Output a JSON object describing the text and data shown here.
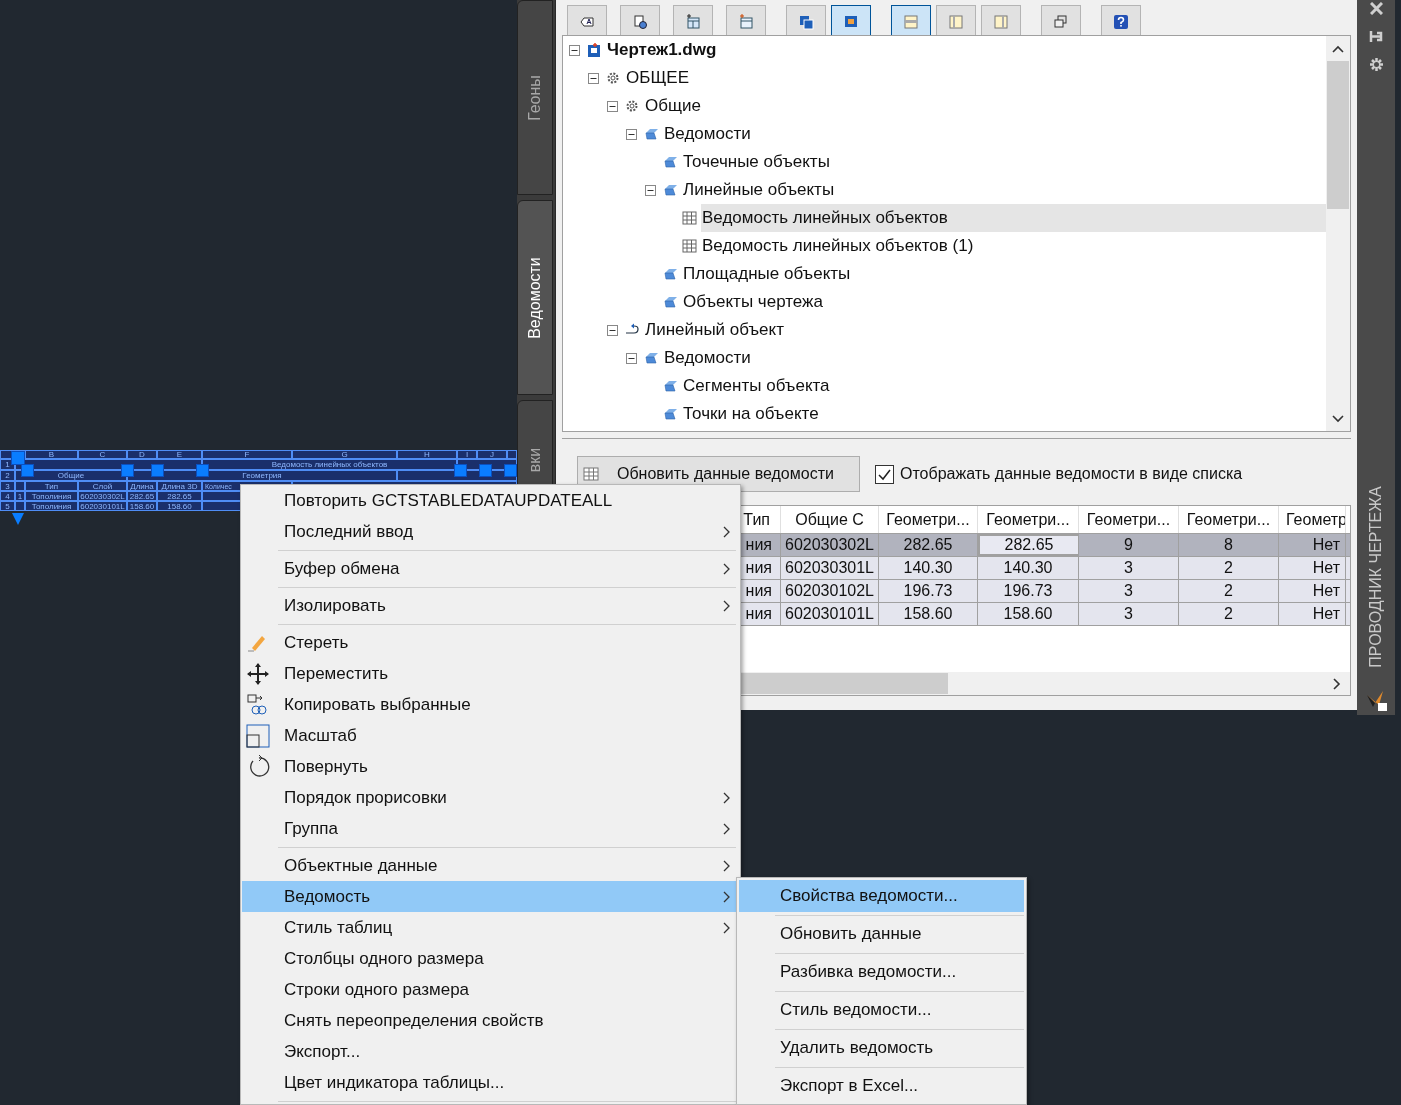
{
  "drawing_table": {
    "column_letters": [
      "B",
      "C",
      "D",
      "E",
      "F",
      "G",
      "H",
      "I",
      "J"
    ],
    "title": "Ведомость линейных объектов",
    "group_headers": [
      "Общие",
      "Геометрия"
    ],
    "row_numbers": [
      "1",
      "2",
      "3",
      "4",
      "5"
    ],
    "headers": [
      "Тип",
      "Слой",
      "Длина",
      "Длина 3D",
      "Количес"
    ],
    "rows": [
      {
        "number": "1",
        "cells": [
          "Тополиния",
          "602030302L",
          "282.65",
          "282.65"
        ]
      },
      {
        "cells": [
          "Тополиния",
          "602030101L",
          "158.60",
          "158.60"
        ]
      }
    ]
  },
  "side_tabs": [
    {
      "label": "Геоны",
      "selected": false
    },
    {
      "label": "Ведомости",
      "selected": true
    },
    {
      "label": "вки",
      "selected": false
    }
  ],
  "toolbar": [
    [
      {
        "kind": "label",
        "selected": false
      },
      {
        "kind": "find",
        "selected": false
      },
      {
        "kind": "add-table",
        "selected": false
      },
      {
        "kind": "add-list",
        "selected": false
      }
    ],
    [
      {
        "kind": "copy",
        "selected": false
      },
      {
        "kind": "paste",
        "selected": true
      }
    ],
    [
      {
        "kind": "panel-top",
        "selected": true
      },
      {
        "kind": "panel-left",
        "selected": false
      },
      {
        "kind": "panel-right",
        "selected": false
      }
    ],
    [
      {
        "kind": "windows",
        "selected": false
      }
    ],
    [
      {
        "kind": "help",
        "selected": false
      }
    ]
  ],
  "tree": [
    {
      "label": "Чертеж1.dwg",
      "kind": "drawing",
      "expanded": true,
      "selected": false,
      "children": [
        {
          "label": "ОБЩЕЕ",
          "kind": "gear",
          "expanded": true,
          "selected": false,
          "children": [
            {
              "label": "Общие",
              "kind": "gear",
              "expanded": true,
              "selected": false,
              "children": [
                {
                  "label": "Ведомости",
                  "kind": "folder",
                  "expanded": true,
                  "selected": false,
                  "children": [
                    {
                      "label": "Точечные объекты",
                      "kind": "folder",
                      "selected": false
                    },
                    {
                      "label": "Линейные объекты",
                      "kind": "folder",
                      "expanded": true,
                      "selected": false,
                      "children": [
                        {
                          "label": "Ведомость линейных объектов",
                          "kind": "table",
                          "selected": true
                        },
                        {
                          "label": "Ведомость линейных объектов (1)",
                          "kind": "table",
                          "selected": false
                        }
                      ]
                    },
                    {
                      "label": "Площадные объекты",
                      "kind": "folder",
                      "selected": false
                    },
                    {
                      "label": "Объекты чертежа",
                      "kind": "folder",
                      "selected": false
                    }
                  ]
                }
              ]
            },
            {
              "label": "Линейный объект",
              "kind": "line",
              "expanded": true,
              "selected": false,
              "children": [
                {
                  "label": "Ведомости",
                  "kind": "folder",
                  "expanded": true,
                  "selected": false,
                  "children": [
                    {
                      "label": "Сегменты объекта",
                      "kind": "folder",
                      "selected": false
                    },
                    {
                      "label": "Точки на объекте",
                      "kind": "folder",
                      "selected": false
                    }
                  ]
                }
              ]
            }
          ]
        }
      ]
    }
  ],
  "update_button": {
    "label": "Обновить данные ведомости"
  },
  "list_view_checkbox": {
    "label": "Отображать данные ведомости в виде списка",
    "checked": true
  },
  "grid": {
    "columns": [
      "Тип",
      "Общие С",
      "Геометри...",
      "Геометри...",
      "Геометри...",
      "Геометри...",
      "Геометр"
    ],
    "rows": [
      {
        "selected": true,
        "cells": [
          {
            "text": "ния",
            "focused": false
          },
          {
            "text": "602030302L",
            "focused": false
          },
          {
            "text": "282.65",
            "focused": false
          },
          {
            "text": "282.65",
            "focused": true
          },
          {
            "text": "9",
            "focused": false
          },
          {
            "text": "8",
            "focused": false
          },
          {
            "text": "Нет",
            "focused": false
          }
        ]
      },
      {
        "selected": false,
        "cells": [
          {
            "text": "ния",
            "focused": false
          },
          {
            "text": "602030301L",
            "focused": false
          },
          {
            "text": "140.30",
            "focused": false
          },
          {
            "text": "140.30",
            "focused": false
          },
          {
            "text": "3",
            "focused": false
          },
          {
            "text": "2",
            "focused": false
          },
          {
            "text": "Нет",
            "focused": false
          }
        ]
      },
      {
        "selected": false,
        "cells": [
          {
            "text": "ния",
            "focused": false
          },
          {
            "text": "602030102L",
            "focused": false
          },
          {
            "text": "196.73",
            "focused": false
          },
          {
            "text": "196.73",
            "focused": false
          },
          {
            "text": "3",
            "focused": false
          },
          {
            "text": "2",
            "focused": false
          },
          {
            "text": "Нет",
            "focused": false
          }
        ]
      },
      {
        "selected": false,
        "cells": [
          {
            "text": "ния",
            "focused": false
          },
          {
            "text": "602030101L",
            "focused": false
          },
          {
            "text": "158.60",
            "focused": false
          },
          {
            "text": "158.60",
            "focused": false
          },
          {
            "text": "3",
            "focused": false
          },
          {
            "text": "2",
            "focused": false
          },
          {
            "text": "Нет",
            "focused": false
          }
        ]
      }
    ]
  },
  "explorer_strip": {
    "title": "ПРОВОДНИК ЧЕРТЕЖА"
  },
  "context_menu": [
    {
      "kind": "item",
      "label": "Повторить GCTSTABLEDATAUPDATEALL",
      "submenu": false,
      "selected": false
    },
    {
      "kind": "item",
      "label": "Последний ввод",
      "submenu": true,
      "selected": false
    },
    {
      "kind": "separator"
    },
    {
      "kind": "item",
      "label": "Буфер обмена",
      "submenu": true,
      "selected": false
    },
    {
      "kind": "separator"
    },
    {
      "kind": "item",
      "label": "Изолировать",
      "submenu": true,
      "selected": false
    },
    {
      "kind": "separator"
    },
    {
      "kind": "eraser",
      "label": "Стереть",
      "submenu": false,
      "selected": false
    },
    {
      "kind": "move",
      "label": "Переместить",
      "submenu": false,
      "selected": false
    },
    {
      "kind": "copy",
      "label": "Копировать выбранные",
      "submenu": false,
      "selected": false
    },
    {
      "kind": "scale",
      "label": "Масштаб",
      "submenu": false,
      "selected": false
    },
    {
      "kind": "rotate",
      "label": "Повернуть",
      "submenu": false,
      "selected": false
    },
    {
      "kind": "item",
      "label": "Порядок прорисовки",
      "submenu": true,
      "selected": false
    },
    {
      "kind": "item",
      "label": "Группа",
      "submenu": true,
      "selected": false
    },
    {
      "kind": "separator"
    },
    {
      "kind": "item",
      "label": "Объектные данные",
      "submenu": true,
      "selected": false
    },
    {
      "kind": "item",
      "label": "Ведомость",
      "submenu": true,
      "selected": true
    },
    {
      "kind": "item",
      "label": "Стиль таблиц",
      "submenu": true,
      "selected": false
    },
    {
      "kind": "item",
      "label": "Столбцы одного размера",
      "submenu": false,
      "selected": false
    },
    {
      "kind": "item",
      "label": "Строки одного размера",
      "submenu": false,
      "selected": false
    },
    {
      "kind": "item",
      "label": "Снять переопределения свойств",
      "submenu": false,
      "selected": false
    },
    {
      "kind": "item",
      "label": "Экспорт...",
      "submenu": false,
      "selected": false
    },
    {
      "kind": "item",
      "label": "Цвет индикатора таблицы...",
      "submenu": false,
      "selected": false
    },
    {
      "kind": "separator"
    }
  ],
  "submenu": [
    {
      "label": "Свойства ведомости...",
      "selected": true
    },
    {
      "label": "Обновить данные",
      "selected": false
    },
    {
      "label": "Разбивка ведомости...",
      "selected": false
    },
    {
      "label": "Стиль ведомости...",
      "selected": false
    },
    {
      "label": "Удалить ведомость",
      "selected": false
    },
    {
      "label": "Экспорт в Excel...",
      "selected": false
    }
  ]
}
